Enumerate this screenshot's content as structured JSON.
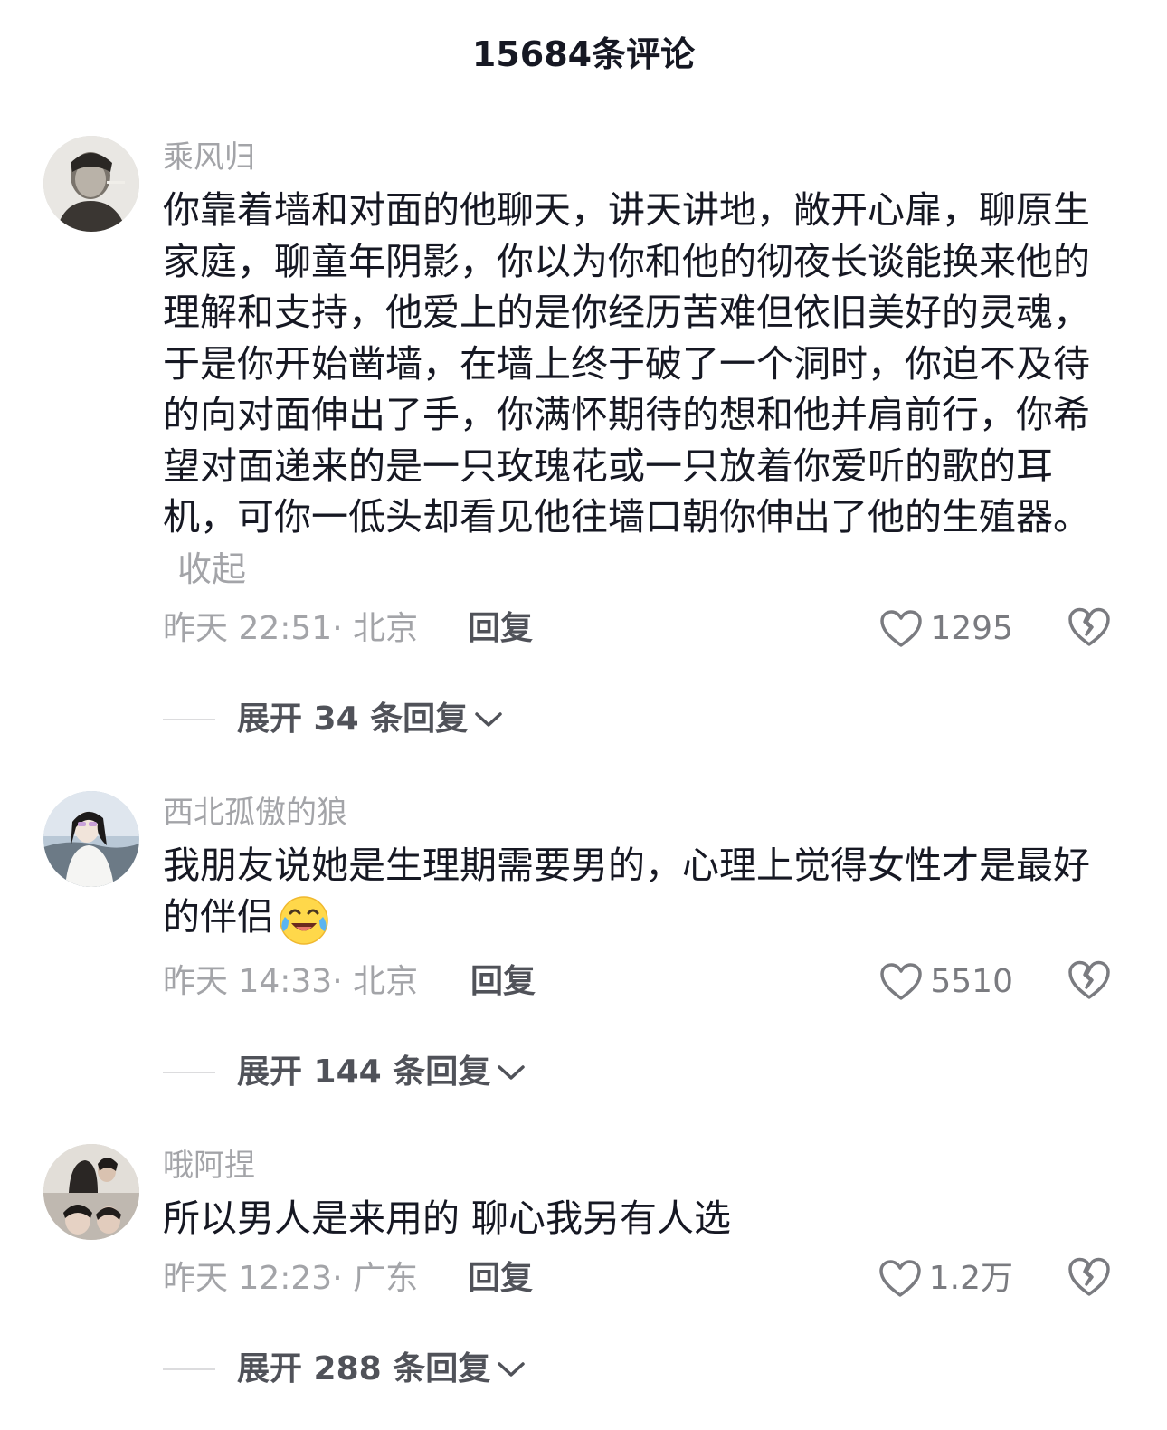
{
  "header": {
    "title": "15684条评论"
  },
  "comments": [
    {
      "username": "乘风归",
      "text": "你靠着墙和对面的他聊天，讲天讲地，敞开心扉，聊原生家庭，聊童年阴影，你以为你和他的彻夜长谈能换来他的理解和支持，他爱上的是你经历苦难但依旧美好的灵魂，于是你开始凿墙，在墙上终于破了一个洞时，你迫不及待的向对面伸出了手，你满怀期待的想和他并肩前行，你希望对面递来的是一只玫瑰花或一只放着你爱听的歌的耳机，可你一低头却看见他往墙口朝你伸出了他的生殖器。",
      "collapse_label": "收起",
      "time_location": "昨天 22:51· 北京",
      "reply_label": "回复",
      "likes": "1295",
      "expand_label": "展开 34 条回复"
    },
    {
      "username": "西北孤傲的狼",
      "text": "我朋友说她是生理期需要男的，心理上觉得女性才是最好的伴侣",
      "emoji": "crying-laughing-emoji",
      "time_location": "昨天 14:33· 北京",
      "reply_label": "回复",
      "likes": "5510",
      "expand_label": "展开 144 条回复"
    },
    {
      "username": "哦阿捏",
      "text": "所以男人是来用的 聊心我另有人选",
      "time_location": "昨天 12:23· 广东",
      "reply_label": "回复",
      "likes": "1.2万",
      "expand_label": "展开 288 条回复"
    }
  ],
  "icons": {
    "like": "heart-outline-icon",
    "dislike": "broken-heart-icon",
    "expand": "chevron-down-icon"
  },
  "colors": {
    "primary_text": "#161823",
    "secondary_text": "#a3a4a8",
    "action_text": "#505259"
  }
}
